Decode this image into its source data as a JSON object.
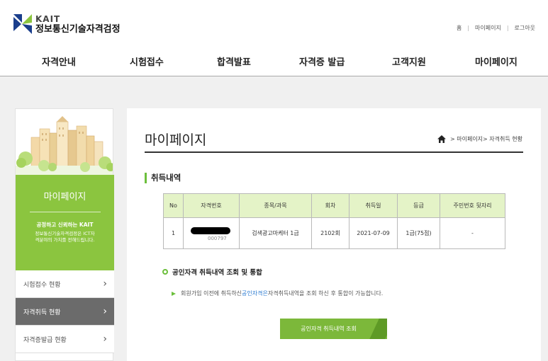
{
  "header": {
    "logo_kait": "KAIT",
    "logo_name": "정보통신기술자격검정",
    "util_links": [
      "홈",
      "마이페이지",
      "로그아웃"
    ]
  },
  "gnb": [
    "자격안내",
    "시험접수",
    "합격발표",
    "자격증 발급",
    "고객지원",
    "마이페이지"
  ],
  "sidebar": {
    "title": "마이페이지",
    "slogan": "공정하고 신뢰하는 KAIT",
    "desc": "정보통신기술자격검정은 ICT자격분야의 가치를 전해드립니다.",
    "menu": [
      "시험접수 현황",
      "자격취득 현황",
      "자격증발급 현황"
    ],
    "active_index": 1
  },
  "main": {
    "title": "마이페이지",
    "breadcrumb": [
      "마이페이지",
      "자격취득 현황"
    ],
    "section_title": "취득내역",
    "table": {
      "columns": [
        "No",
        "자격번호",
        "종목/과목",
        "회차",
        "취득일",
        "등급",
        "주민번호 뒷자리"
      ],
      "rows": [
        {
          "no": "1",
          "cert_no_tail": "000797",
          "subject": "검색광고마케터 1급",
          "round": "2102회",
          "date": "2021-07-09",
          "grade": "1급(75점)",
          "rrn": "-"
        }
      ]
    },
    "sub_title": "공인자격 취득내역 조회 및 통합",
    "note_before": "회원가입 이전에 취득하신 ",
    "note_link": "공인자격은",
    "note_after": " 자격취득내역을 조회 하신 후 통합이 가능합니다.",
    "cta_label": "공인자격 취득내역 조회"
  },
  "colors": {
    "accent_green": "#8bc53f",
    "header_green": "#e4f3c7",
    "active_gray": "#6b6b6b"
  }
}
